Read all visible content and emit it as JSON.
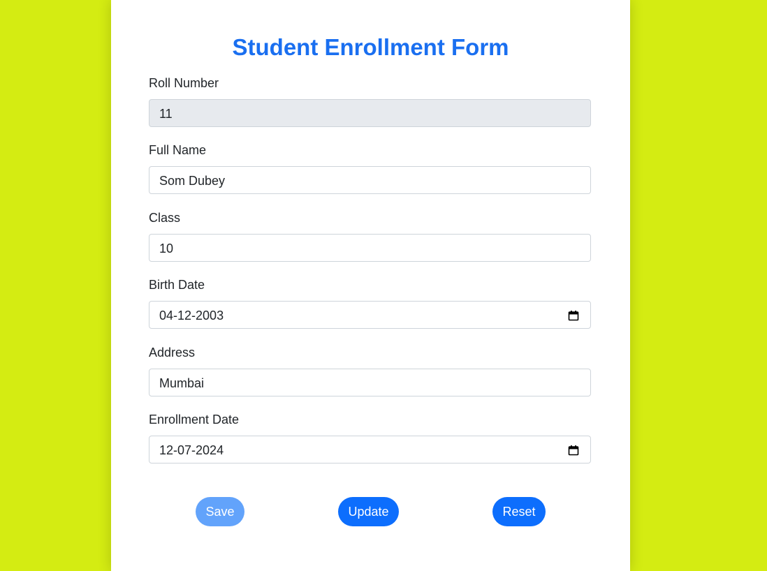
{
  "form": {
    "title": "Student Enrollment Form",
    "fields": [
      {
        "label": "Roll Number",
        "value": "11"
      },
      {
        "label": "Full Name",
        "value": "Som Dubey"
      },
      {
        "label": "Class",
        "value": "10"
      },
      {
        "label": "Birth Date",
        "value": "04-12-2003"
      },
      {
        "label": "Address",
        "value": "Mumbai"
      },
      {
        "label": "Enrollment Date",
        "value": "12-07-2024"
      }
    ]
  },
  "buttons": {
    "save": "Save",
    "update": "Update",
    "reset": "Reset"
  },
  "colors": {
    "background": "#d4ec12",
    "title": "#1a6ff0",
    "primary_button": "#0d6efd",
    "disabled_button": "#62a3fb",
    "readonly_field": "#e7eaee"
  },
  "icons": {
    "date_picker": "calendar-icon"
  }
}
